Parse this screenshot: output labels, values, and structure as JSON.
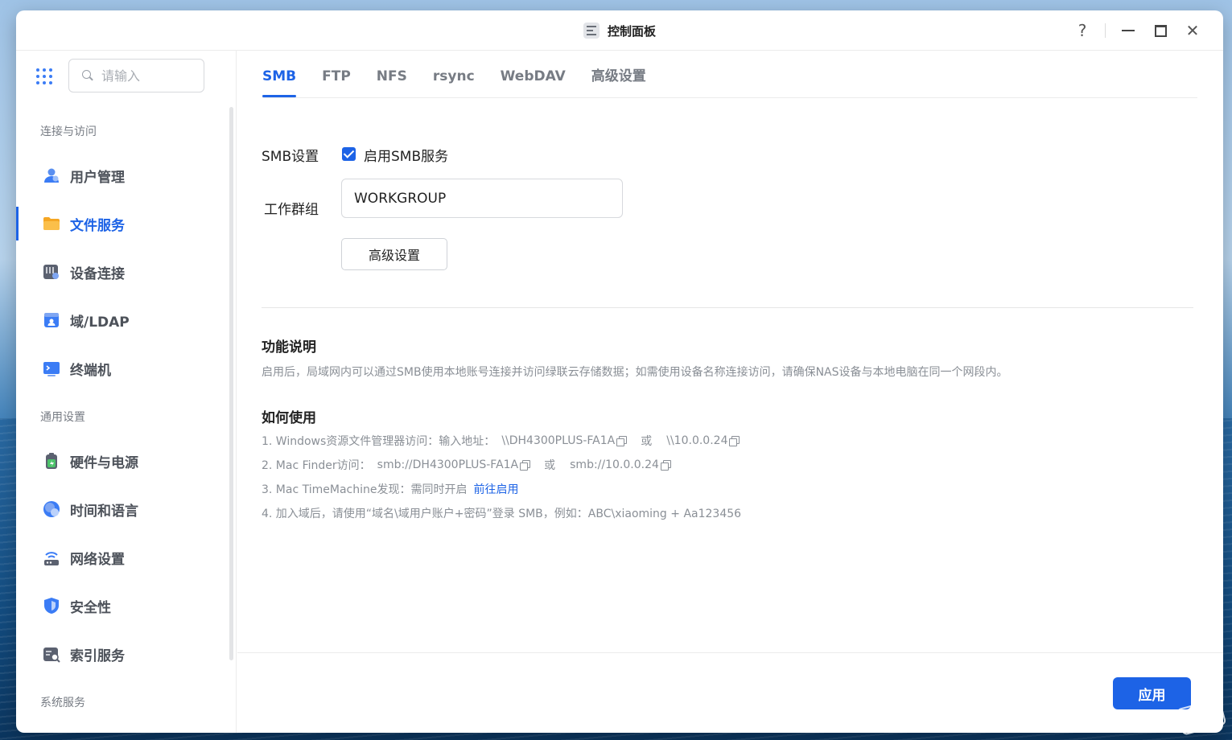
{
  "window": {
    "title": "控制面板",
    "help_glyph": "?",
    "close_glyph": "✕"
  },
  "sidebar": {
    "search_placeholder": "请输入",
    "groups": [
      {
        "label": "连接与访问"
      },
      {
        "label": "通用设置"
      },
      {
        "label": "系统服务"
      }
    ],
    "items": [
      {
        "label": "用户管理",
        "icon": "user-management-icon"
      },
      {
        "label": "文件服务",
        "icon": "folder-icon",
        "active": true
      },
      {
        "label": "设备连接",
        "icon": "device-connection-icon"
      },
      {
        "label": "域/LDAP",
        "icon": "ldap-icon"
      },
      {
        "label": "终端机",
        "icon": "terminal-icon"
      },
      {
        "label": "硬件与电源",
        "icon": "battery-icon"
      },
      {
        "label": "时间和语言",
        "icon": "globe-icon"
      },
      {
        "label": "网络设置",
        "icon": "router-icon"
      },
      {
        "label": "安全性",
        "icon": "shield-icon"
      },
      {
        "label": "索引服务",
        "icon": "index-icon"
      }
    ]
  },
  "tabs": [
    {
      "label": "SMB",
      "active": true
    },
    {
      "label": "FTP"
    },
    {
      "label": "NFS"
    },
    {
      "label": "rsync"
    },
    {
      "label": "WebDAV"
    },
    {
      "label": "高级设置"
    }
  ],
  "smb": {
    "settings_label": "SMB设置",
    "enable_label": "启用SMB服务",
    "enabled": true,
    "workgroup_label": "工作群组",
    "workgroup_value": "WORKGROUP",
    "advanced_button": "高级设置"
  },
  "info": {
    "feature_title": "功能说明",
    "feature_desc": "启用后，局域网内可以通过SMB使用本地账号连接并访问绿联云存储数据；如需使用设备名称连接访问，请确保NAS设备与本地电脑在同一个网段内。",
    "howto_title": "如何使用",
    "or_text": "或",
    "line1_prefix": "1. Windows资源文件管理器访问：输入地址：",
    "line1_addr1": "\\\\DH4300PLUS-FA1A",
    "line1_addr2": "\\\\10.0.0.24",
    "line2_prefix": "2. Mac Finder访问：",
    "line2_addr1": "smb://DH4300PLUS-FA1A",
    "line2_addr2": "smb://10.0.0.24",
    "line3_prefix": "3. Mac TimeMachine发现：需同时开启",
    "line3_link": "前往启用",
    "line4": "4. 加入域后，请使用“域名\\域用户账户+密码”登录 SMB，例如：ABC\\xiaoming + Aa123456"
  },
  "footer": {
    "apply_label": "应用"
  },
  "colors": {
    "accent": "#1d63e6",
    "folder": "#f5a623"
  }
}
